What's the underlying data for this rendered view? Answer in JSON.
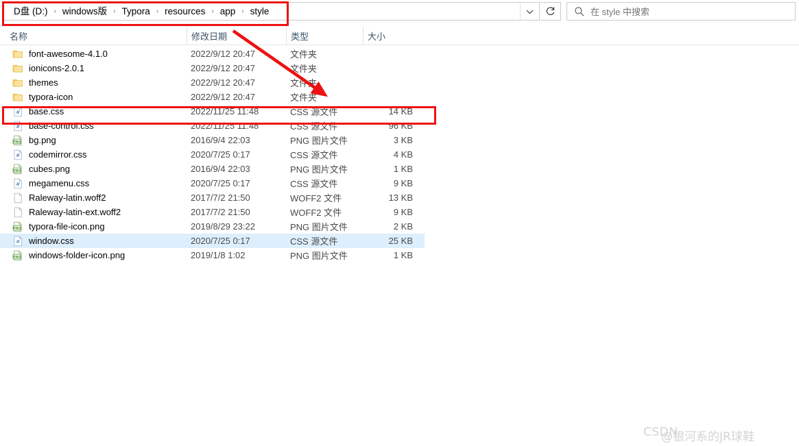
{
  "window": {
    "address_bar": {
      "breadcrumbs": [
        "D盘 (D:)",
        "windows版",
        "Typora",
        "resources",
        "app",
        "style"
      ],
      "separator": "›",
      "dropdown_icon": "chevron-down-icon"
    },
    "refresh_button": {
      "label": "↻",
      "icon": "refresh-icon"
    },
    "search": {
      "placeholder": "在 style 中搜索",
      "icon": "search-icon"
    }
  },
  "columns": [
    {
      "key": "name",
      "label": "名称"
    },
    {
      "key": "date",
      "label": "修改日期"
    },
    {
      "key": "type",
      "label": "类型"
    },
    {
      "key": "size",
      "label": "大小"
    }
  ],
  "sort": {
    "column": "名称",
    "direction": "ascending",
    "indicator": "caret-up-icon"
  },
  "files": [
    {
      "name": "font-awesome-4.1.0",
      "date": "2022/9/12 20:47",
      "type": "文件夹",
      "size": "",
      "icon": "folder-icon",
      "selected": false
    },
    {
      "name": "ionicons-2.0.1",
      "date": "2022/9/12 20:47",
      "type": "文件夹",
      "size": "",
      "icon": "folder-icon",
      "selected": false
    },
    {
      "name": "themes",
      "date": "2022/9/12 20:47",
      "type": "文件夹",
      "size": "",
      "icon": "folder-icon",
      "selected": false
    },
    {
      "name": "typora-icon",
      "date": "2022/9/12 20:47",
      "type": "文件夹",
      "size": "",
      "icon": "folder-icon",
      "selected": false
    },
    {
      "name": "base.css",
      "date": "2022/11/25 11:48",
      "type": "CSS 源文件",
      "size": "14 KB",
      "icon": "css-file-icon",
      "selected": false
    },
    {
      "name": "base-control.css",
      "date": "2022/11/25 11:48",
      "type": "CSS 源文件",
      "size": "96 KB",
      "icon": "css-file-icon",
      "selected": false
    },
    {
      "name": "bg.png",
      "date": "2016/9/4 22:03",
      "type": "PNG 图片文件",
      "size": "3 KB",
      "icon": "png-file-icon",
      "selected": false
    },
    {
      "name": "codemirror.css",
      "date": "2020/7/25 0:17",
      "type": "CSS 源文件",
      "size": "4 KB",
      "icon": "css-file-icon",
      "selected": false
    },
    {
      "name": "cubes.png",
      "date": "2016/9/4 22:03",
      "type": "PNG 图片文件",
      "size": "1 KB",
      "icon": "png-file-icon",
      "selected": false
    },
    {
      "name": "megamenu.css",
      "date": "2020/7/25 0:17",
      "type": "CSS 源文件",
      "size": "9 KB",
      "icon": "css-file-icon",
      "selected": false
    },
    {
      "name": "Raleway-latin.woff2",
      "date": "2017/7/2 21:50",
      "type": "WOFF2 文件",
      "size": "13 KB",
      "icon": "blank-file-icon",
      "selected": false
    },
    {
      "name": "Raleway-latin-ext.woff2",
      "date": "2017/7/2 21:50",
      "type": "WOFF2 文件",
      "size": "9 KB",
      "icon": "blank-file-icon",
      "selected": false
    },
    {
      "name": "typora-file-icon.png",
      "date": "2019/8/29 23:22",
      "type": "PNG 图片文件",
      "size": "2 KB",
      "icon": "png-file-icon",
      "selected": false
    },
    {
      "name": "window.css",
      "date": "2020/7/25 0:17",
      "type": "CSS 源文件",
      "size": "25 KB",
      "icon": "css-file-icon",
      "selected": true
    },
    {
      "name": "windows-folder-icon.png",
      "date": "2019/1/8 1:02",
      "type": "PNG 图片文件",
      "size": "1 KB",
      "icon": "png-file-icon",
      "selected": false
    }
  ],
  "annotations": {
    "color": "#ee1111",
    "address_bar_box": "highlight rectangle around address bar",
    "base_css_box": "highlight rectangle around base.css row",
    "arrow": "red arrow pointing from column header area down to base.css row"
  },
  "watermark": {
    "primary": "CSDN",
    "secondary": "@银河系的JR球鞋"
  }
}
